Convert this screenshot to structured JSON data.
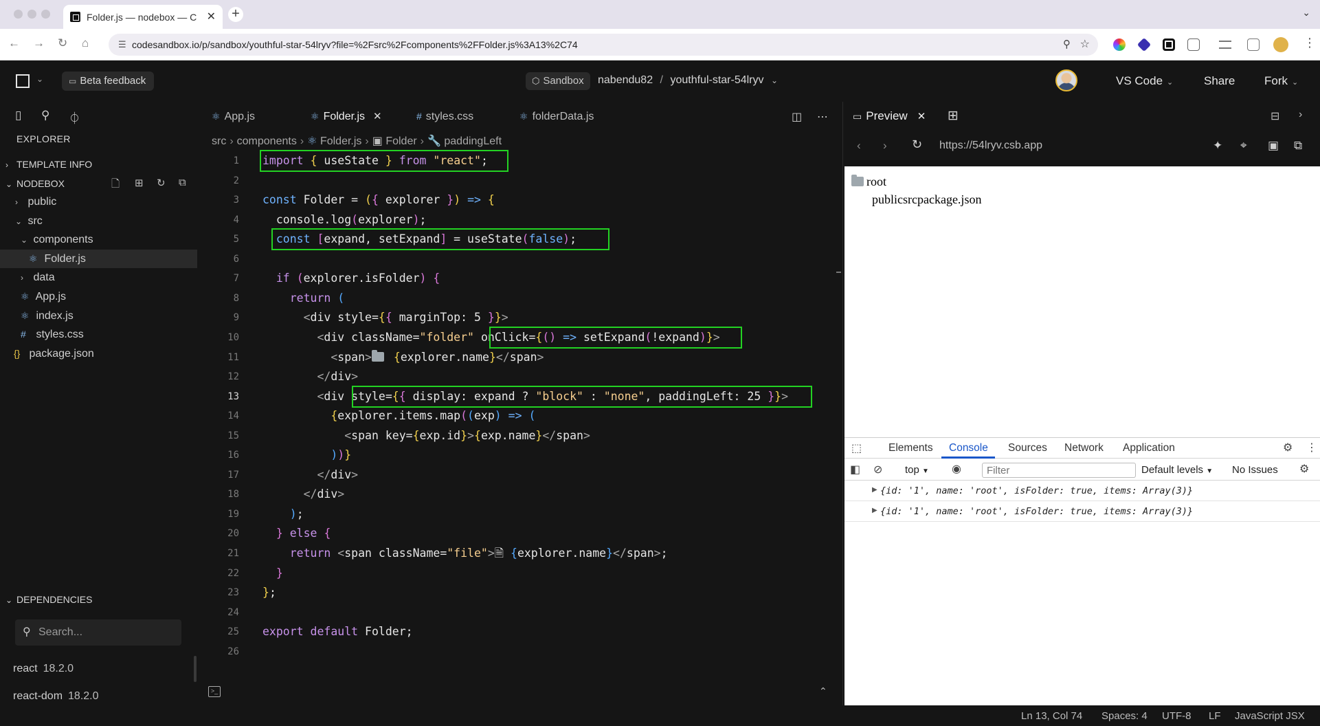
{
  "browser": {
    "tab_title": "Folder.js — nodebox — Code",
    "tab_close": "✕",
    "new_tab": "+",
    "tab_menu": "⌄",
    "url": "codesandbox.io/p/sandbox/youthful-star-54lryv?file=%2Fsrc%2Fcomponents%2FFolder.js%3A13%2C74"
  },
  "header": {
    "beta_feedback": "Beta feedback",
    "sandbox_label": "Sandbox",
    "owner": "nabendu82",
    "separator": "/",
    "project": "youthful-star-54lryv",
    "vscode": "VS Code",
    "share": "Share",
    "fork": "Fork"
  },
  "sidebar": {
    "title": "EXPLORER",
    "template_info": "TEMPLATE INFO",
    "nodebox": "NODEBOX",
    "tree": [
      {
        "label": "public",
        "type": "folder",
        "open": false
      },
      {
        "label": "src",
        "type": "folder",
        "open": true
      },
      {
        "label": "components",
        "type": "folder",
        "open": true
      },
      {
        "label": "Folder.js",
        "type": "react",
        "selected": true
      },
      {
        "label": "data",
        "type": "folder",
        "open": false
      },
      {
        "label": "App.js",
        "type": "react"
      },
      {
        "label": "index.js",
        "type": "react"
      },
      {
        "label": "styles.css",
        "type": "css"
      },
      {
        "label": "package.json",
        "type": "json"
      }
    ],
    "dependencies_title": "DEPENDENCIES",
    "search_placeholder": "Search...",
    "dependencies": [
      {
        "name": "react",
        "version": "18.2.0"
      },
      {
        "name": "react-dom",
        "version": "18.2.0"
      }
    ]
  },
  "editor": {
    "tabs": [
      {
        "label": "App.js",
        "type": "react",
        "active": false
      },
      {
        "label": "Folder.js",
        "type": "react",
        "active": true
      },
      {
        "label": "styles.css",
        "type": "css",
        "active": false
      },
      {
        "label": "folderData.js",
        "type": "react",
        "active": false
      }
    ],
    "breadcrumb": [
      "src",
      "components",
      "Folder.js",
      "Folder",
      "paddingLeft"
    ],
    "current_line": 13
  },
  "preview": {
    "tab_label": "Preview",
    "url": "https://54lryv.csb.app",
    "page_root": "root",
    "page_children": "publicsrcpackage.json"
  },
  "devtools": {
    "tabs": [
      "Elements",
      "Console",
      "Sources",
      "Network",
      "Application"
    ],
    "active_tab": "Console",
    "context": "top",
    "filter_placeholder": "Filter",
    "levels": "Default levels",
    "issues": "No Issues",
    "logs": [
      "{id: '1', name: 'root', isFolder: true, items: Array(3)}",
      "{id: '1', name: 'root', isFolder: true, items: Array(3)}"
    ]
  },
  "status": {
    "position": "Ln 13, Col 74",
    "spaces": "Spaces: 4",
    "encoding": "UTF-8",
    "eol": "LF",
    "language": "JavaScript JSX"
  },
  "colors": {
    "highlight_box": "#23d223",
    "background": "#151515",
    "devtools_accent": "#1a57c9"
  }
}
